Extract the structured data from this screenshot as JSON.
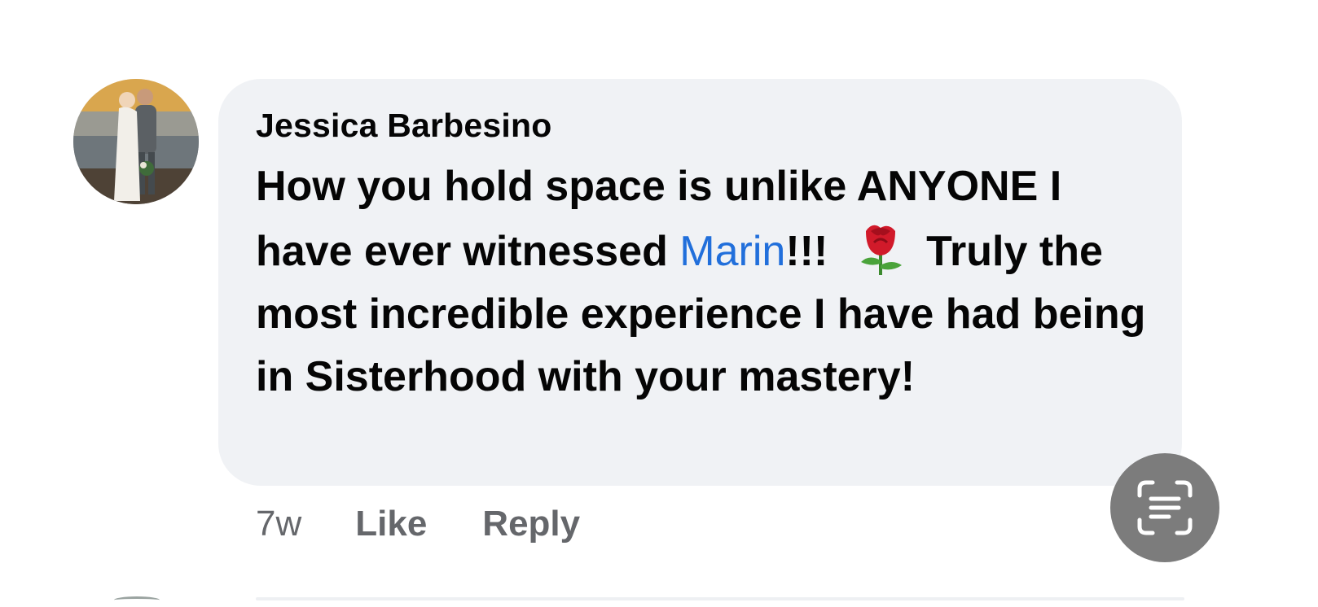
{
  "comment": {
    "author": "Jessica Barbesino",
    "text_part1": "How you hold space is unlike ANYONE I have ever witnessed ",
    "mention": "Marin",
    "text_part2": "!!! ",
    "emoji": "rose",
    "text_part3": " Truly the most incredible experience I have had being in Sisterhood with your mastery!",
    "timestamp": "7w",
    "like_label": "Like",
    "reply_label": "Reply"
  },
  "icons": {
    "avatar": "profile-photo",
    "scan": "live-text-scan-icon"
  },
  "colors": {
    "bubble_bg": "#f0f2f5",
    "mention": "#216fdb",
    "action_text": "#65676b",
    "scan_button_bg": "#7c7c7c"
  }
}
